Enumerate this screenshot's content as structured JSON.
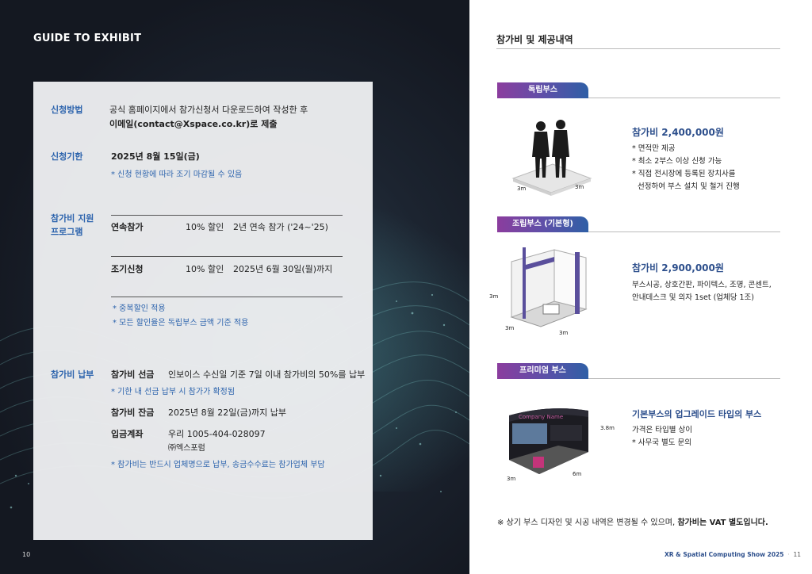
{
  "left": {
    "title": "GUIDE TO EXHIBIT",
    "page_number": "10",
    "apply_method": {
      "label": "신청방법",
      "line1": "공식 홈페이지에서 참가신청서 다운로드하여 작성한 후",
      "line2": "이메일(contact@Xspace.co.kr)로 제출"
    },
    "deadline": {
      "label": "신청기한",
      "date": "2025년 8월 15일(금)",
      "note": "* 신청 현황에 따라 조기 마감될 수 있음"
    },
    "support": {
      "label_line1": "참가비 지원",
      "label_line2": "프로그램",
      "row1": {
        "name": "연속참가",
        "discount": "10% 할인",
        "detail": "2년 연속 참가 ('24~'25)"
      },
      "row2": {
        "name": "조기신청",
        "discount": "10% 할인",
        "detail": "2025년 6월 30일(월)까지"
      },
      "note1": "* 중복할인 적용",
      "note2": "* 모든 할인율은 독립부스 금액 기준 적용"
    },
    "payment": {
      "label": "참가비 납부",
      "advance_name": "참가비 선금",
      "advance_detail": "인보이스 수신일 기준 7일 이내 참가비의 50%를 납부",
      "advance_note": "* 기한 내 선금 납부 시 참가가 확정됨",
      "balance_name": "참가비 잔금",
      "balance_detail": "2025년 8월 22일(금)까지 납부",
      "account_name": "입금계좌",
      "account_number": "우리 1005-404-028097",
      "account_holder": "㈜엑스포럼",
      "final_note": "* 참가비는 반드시 업체명으로 납부, 송금수수료는 참가업체 부담"
    }
  },
  "right": {
    "title": "참가비 및 제공내역",
    "booth1": {
      "tag": "독립부스",
      "price": "참가비 2,400,000원",
      "desc1": "* 면적만 제공",
      "desc2": "* 최소 2부스 이상 신청 가능",
      "desc3": "* 직접 전시장에 등록된 장치사를",
      "desc4": "선정하여 부스 설치 및 철거 진행",
      "dim_a": "3m",
      "dim_b": "3m"
    },
    "booth2": {
      "tag": "조립부스 (기본형)",
      "price": "참가비 2,900,000원",
      "desc1": "부스시공, 상호간판, 파이텍스, 조명, 콘센트,",
      "desc2": "안내데스크 및 의자 1set (업체당 1조)",
      "dim_h": "3m",
      "dim_a": "3m",
      "dim_b": "3m"
    },
    "booth3": {
      "tag": "프리미엄 부스",
      "price": "기본부스의 업그레이드 타입의 부스",
      "desc1": "가격은 타입별 상이",
      "desc2": "* 사무국 별도 문의",
      "sign": "Company Name",
      "dim_h": "3.8m",
      "dim_a": "3m",
      "dim_b": "6m"
    },
    "footnote_prefix": "※ 상기 부스 디자인 및 시공 내역은 변경될 수 있으며, ",
    "footnote_bold": "참가비는 VAT 별도입니다.",
    "footer_show": "XR & Spatial Computing Show 2025",
    "page_number": "11"
  },
  "colors": {
    "accent_blue": "#2d64ad",
    "dark_bg": "#161b24",
    "pill_start": "#8b3d9e",
    "pill_end": "#2f5fa6"
  }
}
